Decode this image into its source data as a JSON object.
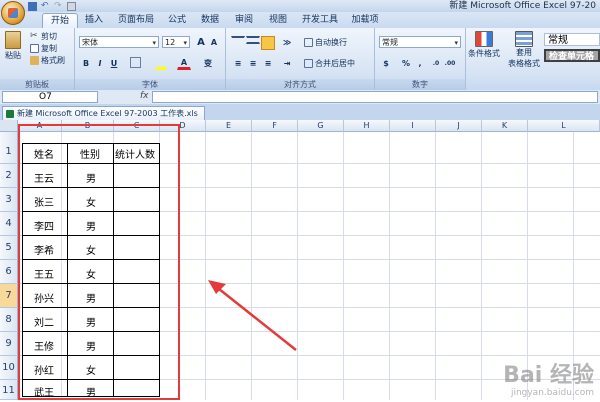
{
  "window": {
    "title": "新建 Microsoft Office Excel 97-20",
    "office_button": "office-button"
  },
  "tabs": [
    "开始",
    "插入",
    "页面布局",
    "公式",
    "数据",
    "审阅",
    "视图",
    "开发工具",
    "加载项"
  ],
  "active_tab": "开始",
  "ribbon": {
    "clipboard": {
      "label": "剪贴板",
      "paste": "粘贴",
      "cut": "剪切",
      "copy": "复制",
      "format_painter": "格式刷"
    },
    "font": {
      "label": "字体",
      "font_name": "宋体",
      "font_size": "12",
      "grow": "A",
      "shrink": "A",
      "bold": "B",
      "italic": "I",
      "underline": "U",
      "text_color_glyph": "A",
      "wen": "变"
    },
    "alignment": {
      "label": "对齐方式",
      "wrap_text": "自动换行",
      "merge_center": "合并后居中"
    },
    "number": {
      "label": "数字",
      "format": "常规",
      "percent": "%",
      "comma": ","
    },
    "styles": {
      "conditional": "条件格式",
      "table": "套用",
      "table2": "表格格式",
      "normal_style": "常规",
      "check_cell": "检查单元格"
    }
  },
  "formula_bar": {
    "name_box": "O7",
    "fx": "fx",
    "formula": ""
  },
  "workbook_tab": "新建 Microsoft Office Excel 97-2003 工作表.xls",
  "columns": [
    "A",
    "B",
    "C",
    "D",
    "E",
    "F",
    "G",
    "H",
    "I",
    "J",
    "K",
    "L"
  ],
  "rows": [
    "1",
    "2",
    "3",
    "4",
    "5",
    "6",
    "7",
    "8",
    "9",
    "10",
    "11"
  ],
  "selected_row": "7",
  "table": {
    "headers": [
      "姓名",
      "性别",
      "统计人数"
    ],
    "data": [
      [
        "王云",
        "男"
      ],
      [
        "张三",
        "女"
      ],
      [
        "李四",
        "男"
      ],
      [
        "李希",
        "女"
      ],
      [
        "王五",
        "女"
      ],
      [
        "孙兴",
        "男"
      ],
      [
        "刘二",
        "男"
      ],
      [
        "王修",
        "男"
      ],
      [
        "孙红",
        "女"
      ],
      [
        "武王",
        "男"
      ]
    ]
  },
  "watermark": {
    "brand": "Bai 经验",
    "url": "jingyan.baidu.com"
  },
  "colors": {
    "accent_red": "#e33b3b",
    "ribbon_blue": "#c9daf0"
  }
}
